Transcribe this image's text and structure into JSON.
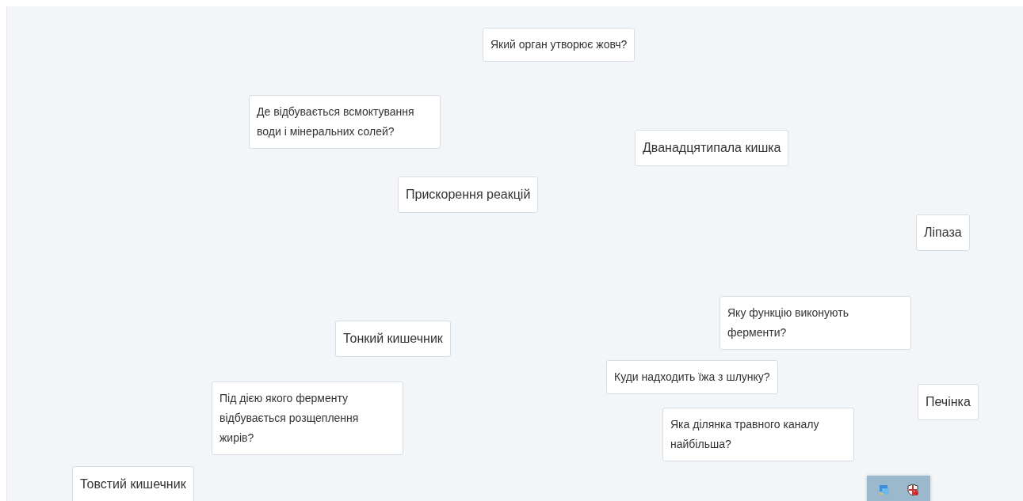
{
  "cards": [
    {
      "kind": "question",
      "text": "Який орган утворює жовч?"
    },
    {
      "kind": "question",
      "text": "Де відбувається всмоктування води і мінеральних солей?"
    },
    {
      "kind": "answer",
      "text": "Дванадцятипала кишка"
    },
    {
      "kind": "answer",
      "text": "Прискорення реакцій"
    },
    {
      "kind": "answer",
      "text": "Ліпаза"
    },
    {
      "kind": "answer",
      "text": "Тонкий кишечник"
    },
    {
      "kind": "question",
      "text": "Яку функцію виконують ферменти?"
    },
    {
      "kind": "question",
      "text": "Під дією якого ферменту відбувається розщеплення жирів?"
    },
    {
      "kind": "question",
      "text": "Куди надходить їжа з шлунку?"
    },
    {
      "kind": "answer",
      "text": "Печінка"
    },
    {
      "kind": "question",
      "text": "Яка ділянка травного каналу найбільша?"
    },
    {
      "kind": "answer",
      "text": "Товстий кишечник"
    }
  ]
}
